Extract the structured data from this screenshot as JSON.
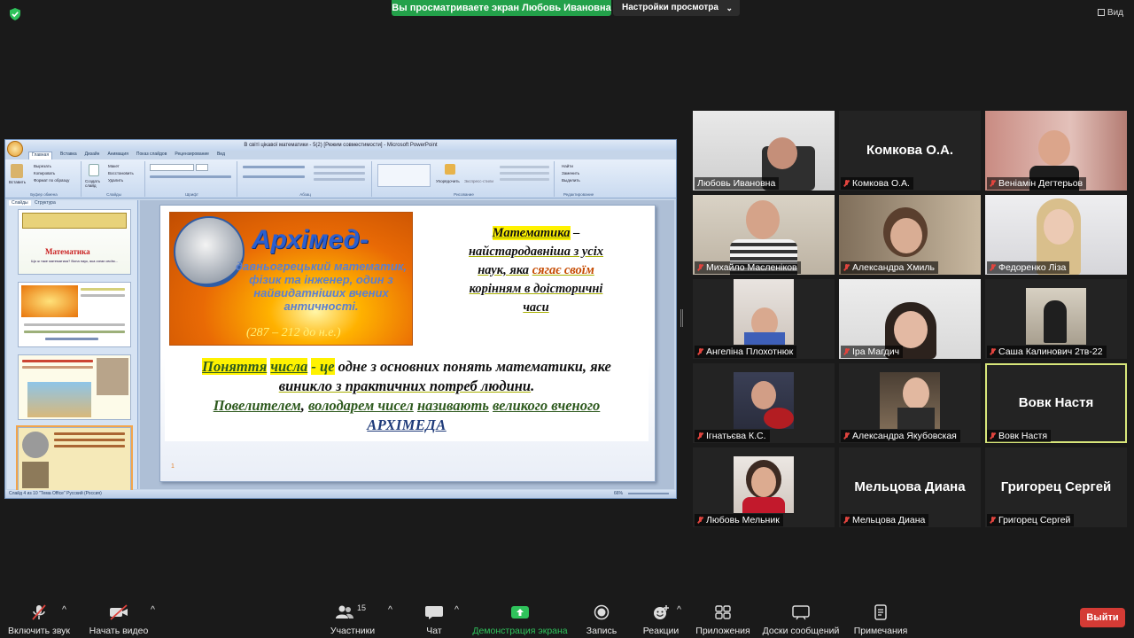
{
  "top_bar": {
    "share_banner": "Вы просматриваете экран Любовь Ивановна",
    "view_settings": "Настройки просмотра",
    "view_button": "Вид"
  },
  "shared_screen": {
    "window_title": "В світі цікавої математики - 5(2) [Режим совместимости] - Microsoft PowerPoint",
    "tabs": [
      "Главная",
      "Вставка",
      "Дизайн",
      "Анимация",
      "Показ слайдов",
      "Рецензирование",
      "Вид"
    ],
    "ribbon_groups": [
      "Буфер обмена",
      "Слайды",
      "Шрифт",
      "Абзац",
      "Рисование",
      "Редактирование"
    ],
    "ribbon_items": {
      "paste": "Вставить",
      "cut": "Вырезать",
      "copy": "Копировать",
      "format_painter": "Формат по образцу",
      "layout": "Макет",
      "reset": "Восстановить",
      "new_slide": "Создать слайд",
      "delete": "Удалить",
      "arrange": "Упорядочить",
      "quick_styles": "Экспресс-стили",
      "find": "Найти",
      "replace": "Заменить",
      "select": "Выделить"
    },
    "side_tabs": [
      "Слайды",
      "Структура"
    ],
    "thumbs": {
      "t1_title": "Математика",
      "t1_text": "Що ж таке математика? Вона наук, яка сягає своїм..."
    },
    "status_text": "Слайд 4 из 10   \"Тема Office\"   Русский (Россия)",
    "zoom": "66%",
    "slide": {
      "arch_title": "Архімед-",
      "arch_subtitle": "давньогрецький математик, фізик та інженер, один з найвидатніших вчених античності.",
      "arch_years": "(287 – 212 до н.е.)",
      "math_word": "Математика",
      "math_rest_1": " –",
      "math_line_2": "найстародавніша з усіх",
      "math_line_3": "наук, яка",
      "math_syagae": "сягає своїм",
      "math_line_4": "корінням в доісторичні",
      "math_line_5": "часи",
      "concept_1": "Поняття",
      "concept_2": "числа",
      "concept_3": "- це",
      "concept_4": " одне з основних понять математики, яке",
      "concept_5": "виникло з практичних потреб людини",
      "concept_6": "Повелителем",
      "concept_7": "володарем чисел",
      "concept_8": "називають",
      "concept_9": "великого вченого",
      "concept_10": "АРХІМЕДА",
      "slide_mark": "1"
    }
  },
  "participants": [
    {
      "name": "Любовь Ивановна",
      "video": true
    },
    {
      "name": "Комкова О.А.",
      "video": false,
      "big": "Комкова О.А."
    },
    {
      "name": "Веніамін Дегтерьов",
      "video": true
    },
    {
      "name": "Михайло Масленіков",
      "video": true
    },
    {
      "name": "Александра Хмиль",
      "video": true
    },
    {
      "name": "Федоренко Ліза",
      "video": true
    },
    {
      "name": "Ангеліна Плохотнюк",
      "video": true
    },
    {
      "name": "Іра Магдич",
      "video": true
    },
    {
      "name": "Саша Калинович 2тв-22",
      "video": true
    },
    {
      "name": "Ігнатьєва К.С.",
      "video": true
    },
    {
      "name": "Александра Якубовская",
      "video": true
    },
    {
      "name": "Вовк Настя",
      "video": false,
      "big": "Вовк Настя"
    },
    {
      "name": "Любовь Мельник",
      "video": true
    },
    {
      "name": "Мельцова Диана",
      "video": false,
      "big": "Мельцова Диана"
    },
    {
      "name": "Григорец Сергей",
      "video": false,
      "big": "Григорец Сергей"
    }
  ],
  "toolbar": {
    "mute": "Включить звук",
    "video": "Начать видео",
    "participants": "Участники",
    "participants_count": "15",
    "chat": "Чат",
    "share": "Демонстрация экрана",
    "record": "Запись",
    "reactions": "Реакции",
    "apps": "Приложения",
    "whiteboards": "Доски сообщений",
    "notes": "Примечания",
    "leave": "Выйти"
  },
  "colors": {
    "share_green": "#23a14a",
    "leave_red": "#d43b35",
    "active_speaker": "#d8e67a",
    "muted_red": "#e0443e"
  }
}
